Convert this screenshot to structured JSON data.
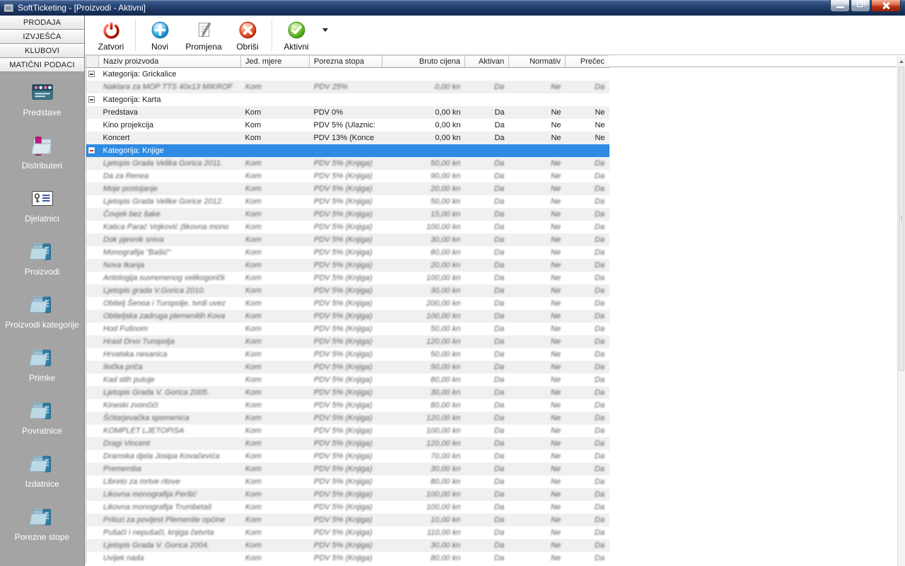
{
  "window": {
    "title": "SoftTicketing - [Proizvodi - Aktivni]"
  },
  "sidebar": {
    "sections": [
      {
        "label": "PRODAJA"
      },
      {
        "label": "IZVJEŠĆA"
      },
      {
        "label": "KLUBOVI"
      },
      {
        "label": "MATIČNI PODACI"
      }
    ],
    "items": [
      {
        "label": "Predstave"
      },
      {
        "label": "Distributeri"
      },
      {
        "label": "Djelatnici"
      },
      {
        "label": "Proizvodi"
      },
      {
        "label": "Proizvodi kategorije"
      },
      {
        "label": "Primke"
      },
      {
        "label": "Povratnice"
      },
      {
        "label": "Izdatnice"
      },
      {
        "label": "Porezne stope"
      }
    ]
  },
  "toolbar": {
    "buttons": [
      {
        "label": "Zatvori"
      },
      {
        "label": "Novi"
      },
      {
        "label": "Promjena"
      },
      {
        "label": "Obriši"
      },
      {
        "label": "Aktivni"
      }
    ]
  },
  "colors": {
    "selection": "#2e8ae2",
    "titlebar": "#1b3560",
    "sidebar": "#a4a4a4"
  },
  "table": {
    "columns": [
      {
        "label": ""
      },
      {
        "label": "Naziv proizvoda"
      },
      {
        "label": "Jed. mjere"
      },
      {
        "label": "Porezna stopa"
      },
      {
        "label": "Bruto cijena"
      },
      {
        "label": "Aktivan"
      },
      {
        "label": "Normativ"
      },
      {
        "label": "Prečec"
      }
    ],
    "groups": [
      {
        "label": "Kategorija: Grickalice",
        "selected": false,
        "rows": [
          {
            "name": "Naklara za MOP TTS 40x13 MIKROF",
            "unit": "Kom",
            "tax": "PDV 25%",
            "price": "0,00 kn",
            "active": "Da",
            "normativ": "Ne",
            "shortcut": "Da",
            "blurred": true
          }
        ]
      },
      {
        "label": "Kategorija: Karta",
        "selected": false,
        "rows": [
          {
            "name": "Predstava",
            "unit": "Kom",
            "tax": "PDV 0%",
            "price": "0,00 kn",
            "active": "Da",
            "normativ": "Ne",
            "shortcut": "Ne",
            "blurred": false
          },
          {
            "name": "Kino projekcija",
            "unit": "Kom",
            "tax": "PDV 5% (Ulaznic:",
            "price": "0,00 kn",
            "active": "Da",
            "normativ": "Ne",
            "shortcut": "Ne",
            "blurred": false
          },
          {
            "name": "Koncert",
            "unit": "Kom",
            "tax": "PDV 13% (Konce",
            "price": "0,00 kn",
            "active": "Da",
            "normativ": "Ne",
            "shortcut": "Ne",
            "blurred": false
          }
        ]
      },
      {
        "label": "Kategorija: Knjige",
        "selected": true,
        "rows": [
          {
            "name": "Ljetopis Grada Velika Gorica 2011.",
            "unit": "Kom",
            "tax": "PDV 5% (Knjiga)",
            "price": "50,00 kn",
            "active": "Da",
            "normativ": "Ne",
            "shortcut": "Da",
            "blurred": true
          },
          {
            "name": "Da za Renea",
            "unit": "Kom",
            "tax": "PDV 5% (Knjiga)",
            "price": "90,00 kn",
            "active": "Da",
            "normativ": "Ne",
            "shortcut": "Da",
            "blurred": true
          },
          {
            "name": "Moje postojanje",
            "unit": "Kom",
            "tax": "PDV 5% (Knjiga)",
            "price": "20,00 kn",
            "active": "Da",
            "normativ": "Ne",
            "shortcut": "Da",
            "blurred": true
          },
          {
            "name": "Ljetopis Grada Velike Gorice 2012.",
            "unit": "Kom",
            "tax": "PDV 5% (Knjiga)",
            "price": "50,00 kn",
            "active": "Da",
            "normativ": "Ne",
            "shortcut": "Da",
            "blurred": true
          },
          {
            "name": "Čovjek bez šake",
            "unit": "Kom",
            "tax": "PDV 5% (Knjiga)",
            "price": "15,00 kn",
            "active": "Da",
            "normativ": "Ne",
            "shortcut": "Da",
            "blurred": true
          },
          {
            "name": "Katica Parać Vojković (likovna mono",
            "unit": "Kom",
            "tax": "PDV 5% (Knjiga)",
            "price": "100,00 kn",
            "active": "Da",
            "normativ": "Ne",
            "shortcut": "Da",
            "blurred": true
          },
          {
            "name": "Dok pjesnik sniva",
            "unit": "Kom",
            "tax": "PDV 5% (Knjiga)",
            "price": "30,00 kn",
            "active": "Da",
            "normativ": "Ne",
            "shortcut": "Da",
            "blurred": true
          },
          {
            "name": "Monografija \"Bašić\"",
            "unit": "Kom",
            "tax": "PDV 5% (Knjiga)",
            "price": "80,00 kn",
            "active": "Da",
            "normativ": "Ne",
            "shortcut": "Da",
            "blurred": true
          },
          {
            "name": "Nova tkanja",
            "unit": "Kom",
            "tax": "PDV 5% (Knjiga)",
            "price": "20,00 kn",
            "active": "Da",
            "normativ": "Ne",
            "shortcut": "Da",
            "blurred": true
          },
          {
            "name": "Antologija suvremenog velikogoričk",
            "unit": "Kom",
            "tax": "PDV 5% (Knjiga)",
            "price": "100,00 kn",
            "active": "Da",
            "normativ": "Ne",
            "shortcut": "Da",
            "blurred": true
          },
          {
            "name": "Ljetopis grada V.Gorica 2010.",
            "unit": "Kom",
            "tax": "PDV 5% (Knjiga)",
            "price": "30,00 kn",
            "active": "Da",
            "normativ": "Ne",
            "shortcut": "Da",
            "blurred": true
          },
          {
            "name": "Obitelj Šenoa i Turopolje, tvrdi uvez",
            "unit": "Kom",
            "tax": "PDV 5% (Knjiga)",
            "price": "200,00 kn",
            "active": "Da",
            "normativ": "Ne",
            "shortcut": "Da",
            "blurred": true
          },
          {
            "name": "Obiteljska zadruga plemenitih Kova",
            "unit": "Kom",
            "tax": "PDV 5% (Knjiga)",
            "price": "100,00 kn",
            "active": "Da",
            "normativ": "Ne",
            "shortcut": "Da",
            "blurred": true
          },
          {
            "name": "Hod Fušnom",
            "unit": "Kom",
            "tax": "PDV 5% (Knjiga)",
            "price": "50,00 kn",
            "active": "Da",
            "normativ": "Ne",
            "shortcut": "Da",
            "blurred": true
          },
          {
            "name": "Hrast Drvo Turopolja",
            "unit": "Kom",
            "tax": "PDV 5% (Knjiga)",
            "price": "120,00 kn",
            "active": "Da",
            "normativ": "Ne",
            "shortcut": "Da",
            "blurred": true
          },
          {
            "name": "Hrvatska nesanica",
            "unit": "Kom",
            "tax": "PDV 5% (Knjiga)",
            "price": "50,00 kn",
            "active": "Da",
            "normativ": "Ne",
            "shortcut": "Da",
            "blurred": true
          },
          {
            "name": "Iločka priča",
            "unit": "Kom",
            "tax": "PDV 5% (Knjiga)",
            "price": "50,00 kn",
            "active": "Da",
            "normativ": "Ne",
            "shortcut": "Da",
            "blurred": true
          },
          {
            "name": "Kad stih putuje",
            "unit": "Kom",
            "tax": "PDV 5% (Knjiga)",
            "price": "80,00 kn",
            "active": "Da",
            "normativ": "Ne",
            "shortcut": "Da",
            "blurred": true
          },
          {
            "name": "Ljetopis Grada V. Gorica 2005.",
            "unit": "Kom",
            "tax": "PDV 5% (Knjiga)",
            "price": "30,00 kn",
            "active": "Da",
            "normativ": "Ne",
            "shortcut": "Da",
            "blurred": true
          },
          {
            "name": "Kineski zvončići",
            "unit": "Kom",
            "tax": "PDV 5% (Knjiga)",
            "price": "80,00 kn",
            "active": "Da",
            "normativ": "Ne",
            "shortcut": "Da",
            "blurred": true
          },
          {
            "name": "Šćitarjevačka spomenica",
            "unit": "Kom",
            "tax": "PDV 5% (Knjiga)",
            "price": "120,00 kn",
            "active": "Da",
            "normativ": "Ne",
            "shortcut": "Da",
            "blurred": true
          },
          {
            "name": "KOMPLET LJETOPISA",
            "unit": "Kom",
            "tax": "PDV 5% (Knjiga)",
            "price": "100,00 kn",
            "active": "Da",
            "normativ": "Ne",
            "shortcut": "Da",
            "blurred": true
          },
          {
            "name": "Dragi Vincent",
            "unit": "Kom",
            "tax": "PDV 5% (Knjiga)",
            "price": "120,00 kn",
            "active": "Da",
            "normativ": "Ne",
            "shortcut": "Da",
            "blurred": true
          },
          {
            "name": "Dramska djela Josipa Kovačevića",
            "unit": "Kom",
            "tax": "PDV 5% (Knjiga)",
            "price": "70,00 kn",
            "active": "Da",
            "normativ": "Ne",
            "shortcut": "Da",
            "blurred": true
          },
          {
            "name": "Prememba",
            "unit": "Kom",
            "tax": "PDV 5% (Knjiga)",
            "price": "30,00 kn",
            "active": "Da",
            "normativ": "Ne",
            "shortcut": "Da",
            "blurred": true
          },
          {
            "name": "Libreto za mrtve ritove",
            "unit": "Kom",
            "tax": "PDV 5% (Knjiga)",
            "price": "80,00 kn",
            "active": "Da",
            "normativ": "Ne",
            "shortcut": "Da",
            "blurred": true
          },
          {
            "name": "Likovna monografija Peršić",
            "unit": "Kom",
            "tax": "PDV 5% (Knjiga)",
            "price": "100,00 kn",
            "active": "Da",
            "normativ": "Ne",
            "shortcut": "Da",
            "blurred": true
          },
          {
            "name": "Likovna monografija Trumbetaš",
            "unit": "Kom",
            "tax": "PDV 5% (Knjiga)",
            "price": "100,00 kn",
            "active": "Da",
            "normativ": "Ne",
            "shortcut": "Da",
            "blurred": true
          },
          {
            "name": "Prilozi za povijest Plemenite općine",
            "unit": "Kom",
            "tax": "PDV 5% (Knjiga)",
            "price": "10,00 kn",
            "active": "Da",
            "normativ": "Ne",
            "shortcut": "Da",
            "blurred": true
          },
          {
            "name": "Pušači i nepušači, knjiga četvrta",
            "unit": "Kom",
            "tax": "PDV 5% (Knjiga)",
            "price": "110,00 kn",
            "active": "Da",
            "normativ": "Ne",
            "shortcut": "Da",
            "blurred": true
          },
          {
            "name": "Ljetopis Grada V. Gorica 2004.",
            "unit": "Kom",
            "tax": "PDV 5% (Knjiga)",
            "price": "30,00 kn",
            "active": "Da",
            "normativ": "Ne",
            "shortcut": "Da",
            "blurred": true
          },
          {
            "name": "Uvijek nada",
            "unit": "Kom",
            "tax": "PDV 5% (Knjiga)",
            "price": "80,00 kn",
            "active": "Da",
            "normativ": "Ne",
            "shortcut": "Da",
            "blurred": true
          }
        ]
      }
    ]
  }
}
